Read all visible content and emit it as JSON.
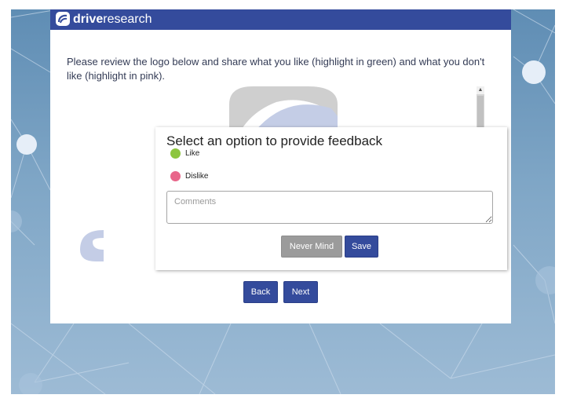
{
  "brand": {
    "prefix": "drive",
    "suffix": "research"
  },
  "survey": {
    "question": "Please review the logo below and share what you like (highlight in green) and what you don't like (highlight in pink)."
  },
  "feedback_popup": {
    "title": "Select an option to provide feedback",
    "options": [
      {
        "label": "Like",
        "color": "#8dc63f"
      },
      {
        "label": "Dislike",
        "color": "#e8668a"
      }
    ],
    "comments_placeholder": "Comments",
    "nevermind_label": "Never Mind",
    "save_label": "Save"
  },
  "navigation": {
    "back_label": "Back",
    "next_label": "Next"
  },
  "colors": {
    "brand_blue": "#344b9c",
    "like_green": "#8dc63f",
    "dislike_pink": "#e8668a",
    "neutral_button": "#9b9b9b"
  },
  "icons": {
    "logo": "drive-research-logo-icon",
    "scroll_up": "chevron-up-icon",
    "scroll_down": "chevron-down-icon"
  }
}
